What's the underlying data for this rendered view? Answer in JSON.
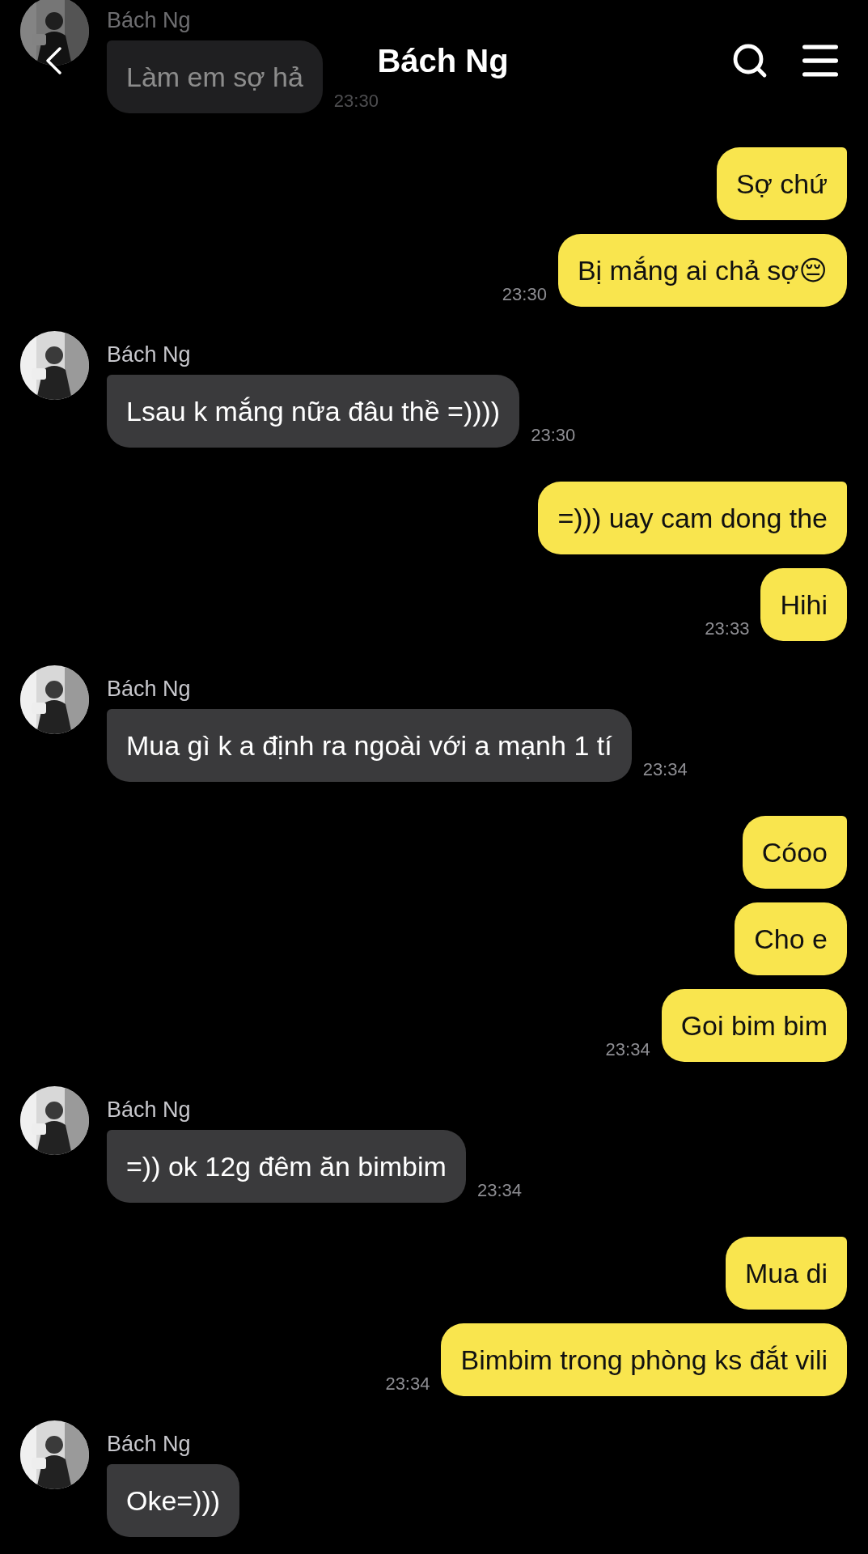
{
  "header": {
    "title": "Bách Ng"
  },
  "groups": [
    {
      "kind": "incoming",
      "name": "Bách Ng",
      "messages": [
        "Làm em sợ hả"
      ],
      "time": "23:30"
    },
    {
      "kind": "outgoing",
      "messages": [
        "Sợ chứ",
        "Bị mắng ai chả sợ😔"
      ],
      "time": "23:30"
    },
    {
      "kind": "incoming",
      "name": "Bách Ng",
      "messages": [
        "Lsau k mắng nữa đâu thề =))))"
      ],
      "time": "23:30"
    },
    {
      "kind": "outgoing",
      "messages": [
        "=))) uay cam dong the",
        "Hihi"
      ],
      "time": "23:33"
    },
    {
      "kind": "incoming",
      "name": "Bách Ng",
      "messages": [
        "Mua gì k a định ra ngoài với a mạnh 1 tí"
      ],
      "time": "23:34"
    },
    {
      "kind": "outgoing",
      "messages": [
        "Cóoo",
        "Cho e",
        "Goi bim bim"
      ],
      "time": "23:34"
    },
    {
      "kind": "incoming",
      "name": "Bách Ng",
      "messages": [
        "=)) ok 12g đêm ăn bimbim"
      ],
      "time": "23:34"
    },
    {
      "kind": "outgoing",
      "messages": [
        "Mua di",
        "Bimbim trong phòng ks đắt vili"
      ],
      "time": "23:34"
    },
    {
      "kind": "incoming",
      "name": "Bách Ng",
      "messages": [
        "Oke=)))"
      ]
    }
  ]
}
